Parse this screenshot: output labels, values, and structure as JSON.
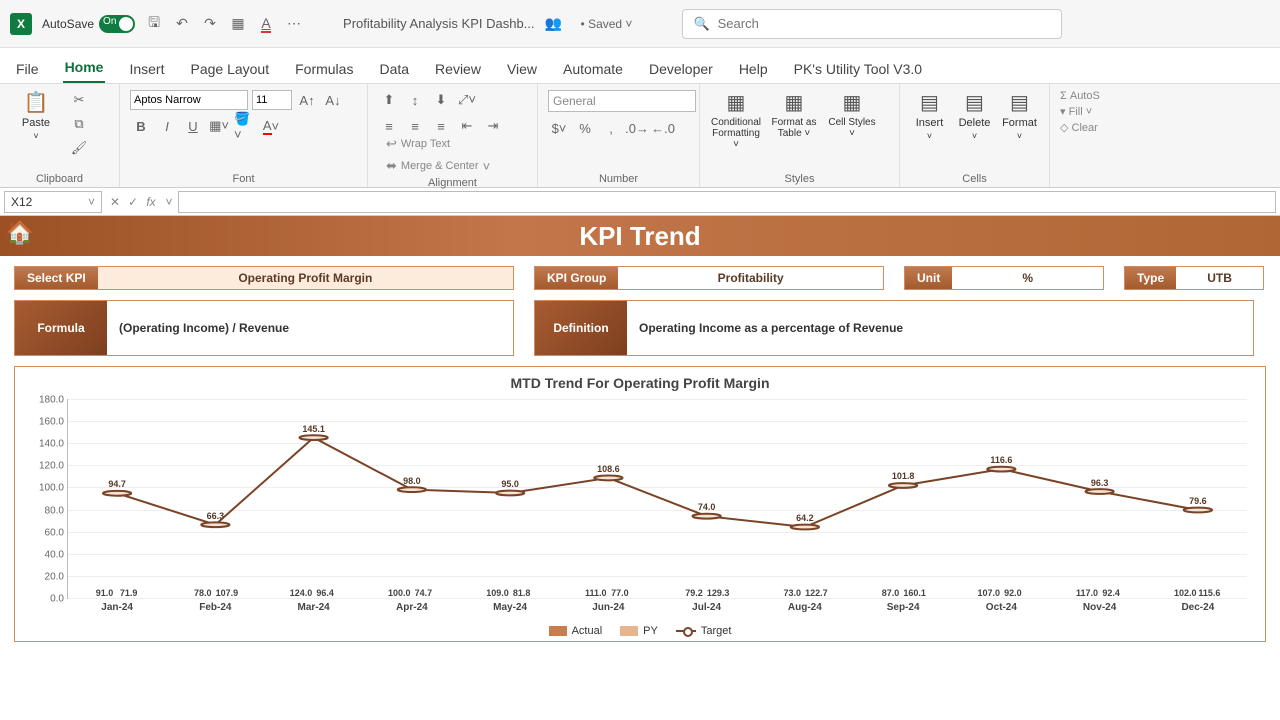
{
  "titlebar": {
    "autosave": "AutoSave",
    "autosave_toggle": "On",
    "doc": "Profitability Analysis KPI Dashb...",
    "saved": "• Saved ˅",
    "search_placeholder": "Search"
  },
  "tabs": [
    "File",
    "Home",
    "Insert",
    "Page Layout",
    "Formulas",
    "Data",
    "Review",
    "View",
    "Automate",
    "Developer",
    "Help",
    "PK's Utility Tool V3.0"
  ],
  "active_tab": "Home",
  "ribbon": {
    "clipboard": {
      "paste": "Paste",
      "label": "Clipboard"
    },
    "font": {
      "name": "Aptos Narrow",
      "size": "11",
      "label": "Font"
    },
    "alignment": {
      "wrap": "Wrap Text",
      "merge": "Merge & Center",
      "label": "Alignment"
    },
    "number": {
      "format": "General",
      "label": "Number"
    },
    "styles": {
      "cond": "Conditional Formatting ˅",
      "table": "Format as Table ˅",
      "cell": "Cell Styles ˅",
      "label": "Styles"
    },
    "cells": {
      "insert": "Insert",
      "delete": "Delete",
      "format": "Format",
      "label": "Cells"
    },
    "editing": {
      "autosum": "Σ AutoS",
      "fill": "Fill ˅",
      "clear": "Clear"
    }
  },
  "formula_bar": {
    "name_box": "X12"
  },
  "dash": {
    "title": "KPI Trend",
    "select_kpi_label": "Select KPI",
    "select_kpi_value": "Operating Profit Margin",
    "kpi_group_label": "KPI Group",
    "kpi_group_value": "Profitability",
    "unit_label": "Unit",
    "unit_value": "%",
    "type_label": "Type",
    "type_value": "UTB",
    "formula_label": "Formula",
    "formula_value": "(Operating Income) / Revenue",
    "definition_label": "Definition",
    "definition_value": "Operating Income as a percentage of Revenue"
  },
  "chart_data": {
    "type": "bar",
    "title": "MTD Trend For Operating Profit Margin",
    "ylabel": "",
    "xlabel": "",
    "ylim": [
      0,
      180
    ],
    "yticks": [
      0,
      20,
      40,
      60,
      80,
      100,
      120,
      140,
      160,
      180
    ],
    "categories": [
      "Jan-24",
      "Feb-24",
      "Mar-24",
      "Apr-24",
      "May-24",
      "Jun-24",
      "Jul-24",
      "Aug-24",
      "Sep-24",
      "Oct-24",
      "Nov-24",
      "Dec-24"
    ],
    "series": [
      {
        "name": "Actual",
        "values": [
          91.0,
          78.0,
          124.0,
          100.0,
          109.0,
          111.0,
          79.2,
          73.0,
          87.0,
          107.0,
          117.0,
          102.0
        ]
      },
      {
        "name": "PY",
        "values": [
          71.9,
          107.9,
          96.4,
          74.7,
          81.8,
          77.0,
          129.3,
          122.7,
          160.1,
          92.0,
          92.4,
          115.6
        ]
      },
      {
        "name": "Target",
        "values": [
          94.7,
          66.3,
          145.1,
          98.0,
          95.0,
          108.6,
          74.0,
          64.2,
          101.8,
          116.6,
          96.3,
          79.6
        ]
      }
    ],
    "legend": [
      "Actual",
      "PY",
      "Target"
    ]
  }
}
